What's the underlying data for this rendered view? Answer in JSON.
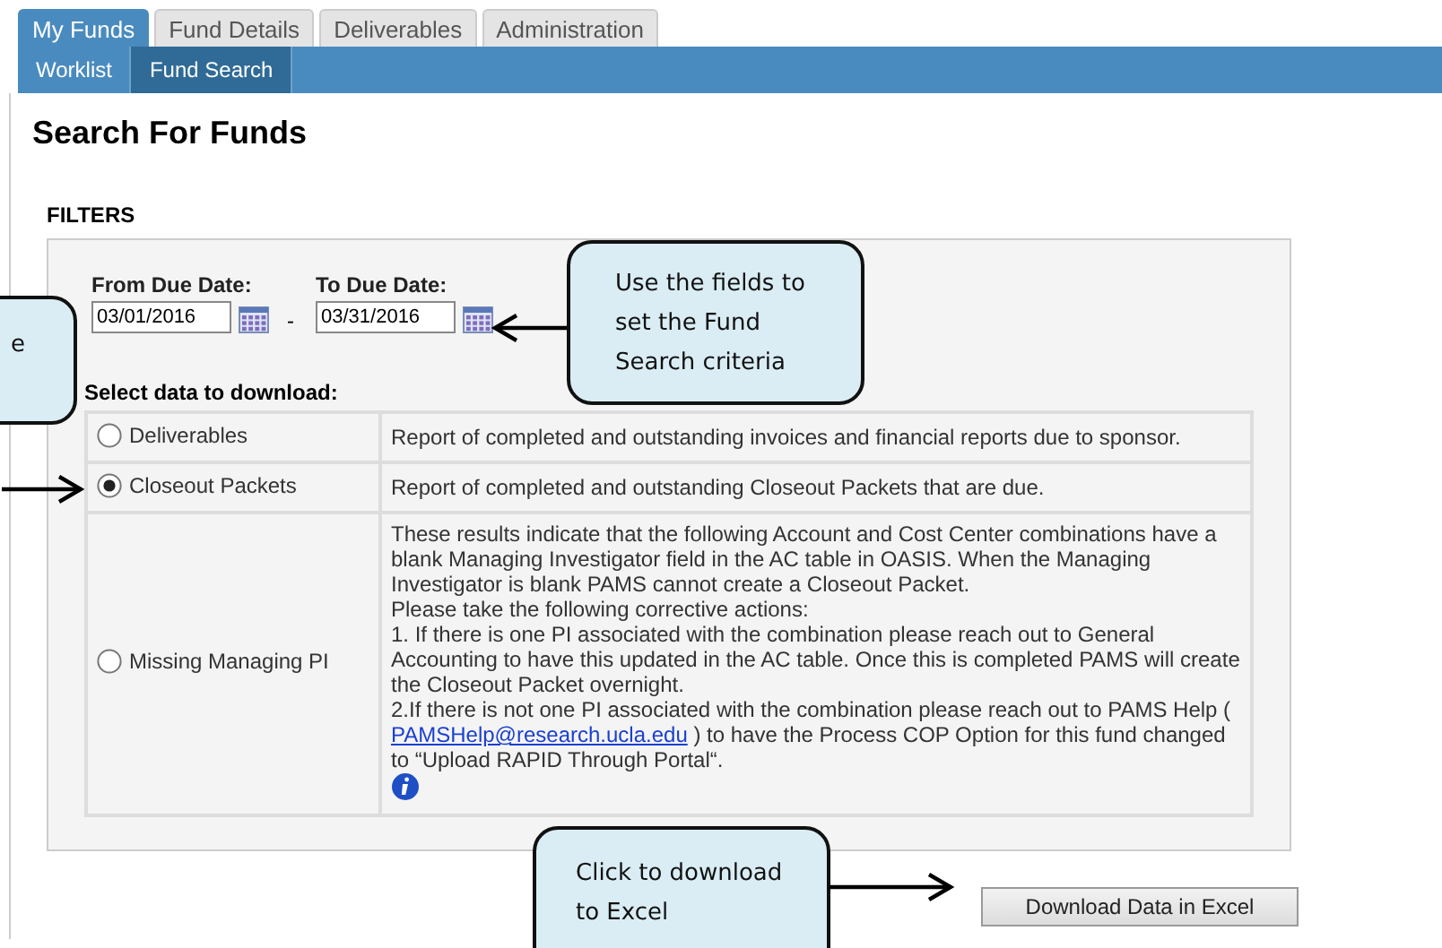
{
  "tabs": [
    {
      "label": "My Funds",
      "selected": true
    },
    {
      "label": "Fund Details",
      "selected": false
    },
    {
      "label": "Deliverables",
      "selected": false
    },
    {
      "label": "Administration",
      "selected": false
    }
  ],
  "subtabs": [
    {
      "label": "Worklist",
      "selected": false
    },
    {
      "label": "Fund Search",
      "selected": true
    }
  ],
  "page_title": "Search For Funds",
  "filters": {
    "heading": "FILTERS",
    "from_date": {
      "label": "From Due Date:",
      "value": "03/01/2016"
    },
    "separator": "-",
    "to_date": {
      "label": "To Due Date:",
      "value": "03/31/2016"
    },
    "select_label": "Select data to download:",
    "options": [
      {
        "kind": "simple",
        "label": "Deliverables",
        "selected": false,
        "description": "Report of completed and outstanding invoices and financial reports due to sponsor."
      },
      {
        "kind": "simple",
        "label": "Closeout Packets",
        "selected": true,
        "description": "Report of completed and outstanding Closeout Packets that are due."
      },
      {
        "kind": "detailed",
        "label": "Missing Managing PI",
        "selected": false,
        "paragraphs": [
          "These results indicate that the following Account and Cost Center combinations have a blank Managing Investigator field in the AC table in OASIS. When the Managing Investigator is blank PAMS cannot create a Closeout Packet.",
          "Please take the following corrective actions:",
          "1. If there is one PI associated with the combination please reach out to General Accounting to have this updated in the AC table. Once this is completed PAMS will create the Closeout Packet overnight."
        ],
        "link_paragraph": {
          "before": "2.If there is not one PI associated with the combination please reach out to PAMS Help ( ",
          "link": "PAMSHelp@research.ucla.edu",
          "after": " ) to have the Process COP Option for this fund changed to “Upload RAPID Through Portal“."
        }
      }
    ]
  },
  "download_button": "Download Data in Excel",
  "callouts": [
    {
      "kind": "left",
      "lines": [
        "e"
      ]
    },
    {
      "kind": "top",
      "lines": [
        "Use the fields to",
        "set the Fund",
        "Search criteria"
      ]
    },
    {
      "kind": "bottom",
      "lines": [
        "Click to download",
        "to Excel"
      ]
    }
  ]
}
